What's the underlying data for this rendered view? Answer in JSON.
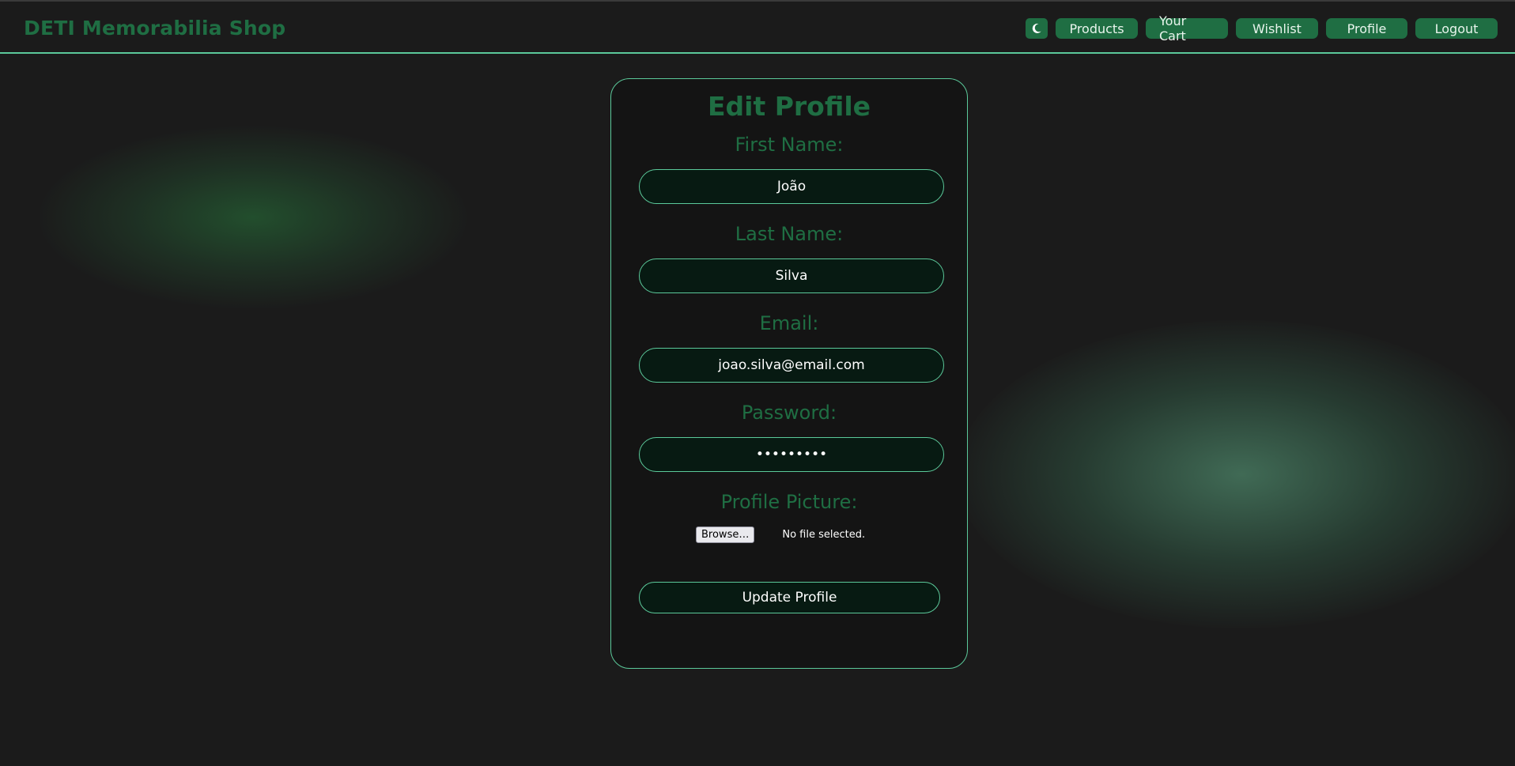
{
  "header": {
    "brand": "DETI Memorabilia Shop",
    "theme_toggle_icon": "moon-icon",
    "nav": {
      "products": "Products",
      "cart": "Your Cart",
      "wishlist": "Wishlist",
      "profile": "Profile",
      "logout": "Logout"
    }
  },
  "form": {
    "title": "Edit Profile",
    "first_name": {
      "label": "First Name:",
      "value": "João"
    },
    "last_name": {
      "label": "Last Name:",
      "value": "Silva"
    },
    "email": {
      "label": "Email:",
      "value": "joao.silva@email.com"
    },
    "password": {
      "label": "Password:",
      "value": "•••••••••"
    },
    "profile_picture": {
      "label": "Profile Picture:",
      "browse_label": "Browse…",
      "status": "No file selected."
    },
    "submit_label": "Update Profile"
  },
  "colors": {
    "accent": "#1f6e43",
    "border": "#5bc99a",
    "background": "#1b1b1b",
    "card": "#141414",
    "input_bg": "#071a12"
  }
}
